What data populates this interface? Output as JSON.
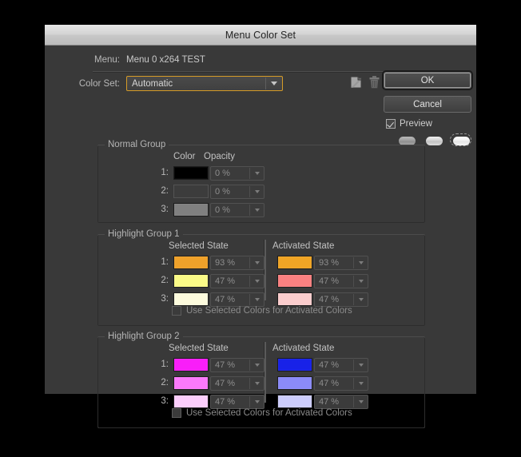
{
  "window": {
    "title": "Menu Color Set"
  },
  "fields": {
    "menu_label": "Menu:",
    "menu_value": "Menu 0 x264 TEST",
    "colorset_label": "Color Set:",
    "colorset_value": "Automatic"
  },
  "toolbar": {
    "icons": [
      {
        "name": "new-color-set-icon",
        "title": "New Color Set"
      },
      {
        "name": "delete-color-set-icon",
        "title": "Delete Color Set"
      },
      {
        "name": "save-color-set-icon",
        "title": "Save Color Set"
      },
      {
        "name": "load-color-set-icon",
        "title": "Load Color Set"
      }
    ]
  },
  "buttons": {
    "ok": "OK",
    "cancel": "Cancel"
  },
  "preview": {
    "label": "Preview",
    "checked": true,
    "pills": [
      {
        "name": "preview-pill-normal",
        "style": "dark",
        "selected": false
      },
      {
        "name": "preview-pill-selected",
        "style": "mid",
        "selected": false
      },
      {
        "name": "preview-pill-activated",
        "style": "light",
        "selected": true
      }
    ]
  },
  "groups": [
    {
      "id": "normal",
      "title": "Normal Group",
      "headers": [
        "Color",
        "Opacity"
      ],
      "two_columns": false,
      "rows": [
        {
          "label": "1:",
          "color": "#000000",
          "empty": false,
          "opacity": "0 %"
        },
        {
          "label": "2:",
          "color": "#3c3c3c",
          "empty": true,
          "opacity": "0 %"
        },
        {
          "label": "3:",
          "color": "#808080",
          "empty": false,
          "opacity": "0 %"
        }
      ]
    },
    {
      "id": "highlight1",
      "title": "Highlight Group 1",
      "headers": [
        "Selected State",
        "Activated State"
      ],
      "two_columns": true,
      "checkbox_label": "Use Selected Colors for Activated Colors",
      "checkbox_checked": false,
      "rows": [
        {
          "label": "1:",
          "sel_color": "#efa12a",
          "sel_opacity": "93 %",
          "act_color": "#f0a525",
          "act_opacity": "93 %"
        },
        {
          "label": "2:",
          "sel_color": "#fbfb87",
          "sel_opacity": "47 %",
          "act_color": "#fa8080",
          "act_opacity": "47 %"
        },
        {
          "label": "3:",
          "sel_color": "#fdfbdd",
          "sel_opacity": "47 %",
          "act_color": "#fbcdcd",
          "act_opacity": "47 %"
        }
      ]
    },
    {
      "id": "highlight2",
      "title": "Highlight Group 2",
      "headers": [
        "Selected State",
        "Activated State"
      ],
      "two_columns": true,
      "checkbox_label": "Use Selected Colors for Activated Colors",
      "checkbox_checked": false,
      "rows": [
        {
          "label": "1:",
          "sel_color": "#f91ef9",
          "sel_opacity": "47 %",
          "act_color": "#1822e8",
          "act_opacity": "47 %"
        },
        {
          "label": "2:",
          "sel_color": "#fb79fb",
          "sel_opacity": "47 %",
          "act_color": "#8b8bf8",
          "act_opacity": "47 %"
        },
        {
          "label": "3:",
          "sel_color": "#fbcdfb",
          "sel_opacity": "47 %",
          "act_color": "#ccccfb",
          "act_opacity": "47 %"
        }
      ]
    }
  ]
}
